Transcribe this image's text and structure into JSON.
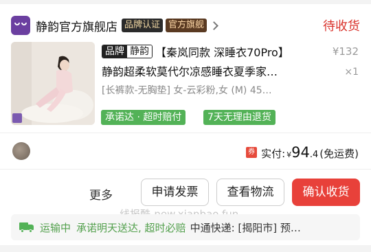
{
  "store": {
    "name": "静韵官方旗舰店",
    "badge_brand_cert": "品牌认证",
    "badge_flagship": "官方旗舰",
    "order_status": "待收货"
  },
  "product": {
    "brand_tag_left": "品牌",
    "brand_tag_right": "静韵",
    "title_line1": "【秦岚同款 深睡衣70Pro】",
    "title_line2": "静韵超柔软莫代尔凉感睡衣夏季家…",
    "price": "¥132",
    "quantity": "×1",
    "sku": "[长裤款-无胸垫] 女-云彩粉,女 (M) 45…",
    "services": [
      "承诺达 · 超时赔付",
      "7天无理由退货"
    ],
    "image_icon": "pajamas-product-photo"
  },
  "payment": {
    "coupon_icon": "券",
    "label": "实付:",
    "currency": "¥",
    "amount_int": "94",
    "amount_dec": ".4",
    "freight_note": "(免运费)"
  },
  "actions": {
    "more": "更多",
    "invoice": "申请发票",
    "logistics": "查看物流",
    "confirm": "确认收货"
  },
  "watermark": "线报酷-new.xianbao.fun",
  "shipping": {
    "icon": "truck-icon",
    "status": "运输中",
    "promise": "承诺明天送达, 超时必赔",
    "info": "中通快递: [揭阳市] 预…"
  },
  "colors": {
    "accent_red": "#e8413a",
    "status_red": "#d9332c",
    "service_green": "#53b257",
    "store_logo": "#6b3fa0"
  }
}
